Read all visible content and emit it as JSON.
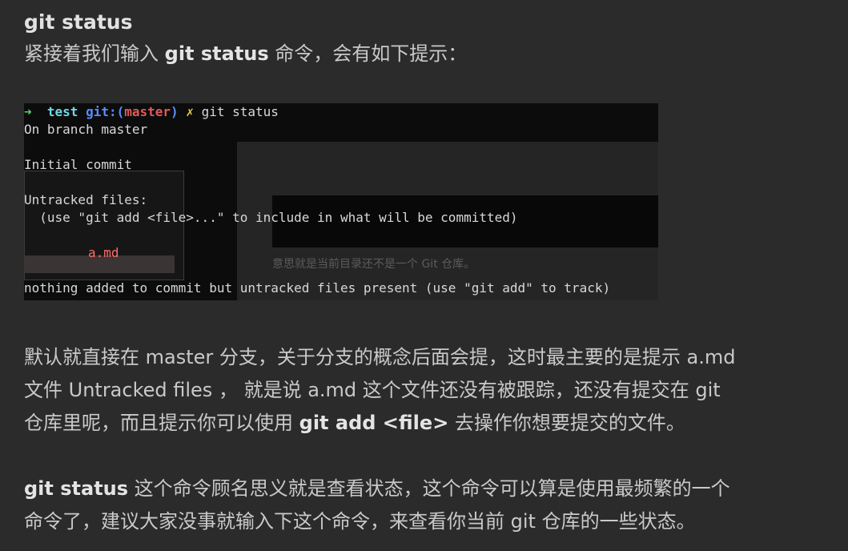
{
  "heading": "git status",
  "intro": {
    "pre": "紧接着我们输入 ",
    "cmd": "git status",
    "post": " 命令，会有如下提示："
  },
  "terminal": {
    "prompt_arrow": "➜",
    "prompt_dir": "test",
    "prompt_git": "git:(",
    "prompt_branch": "master",
    "prompt_close": ")",
    "prompt_x": "✗",
    "prompt_cmd": "git status",
    "lines": [
      "On branch master",
      "Initial commit",
      "Untracked files:",
      "  (use \"git add <file>...\" to include in what will be committed)",
      "a.md",
      "nothing added to commit but untracked files present (use \"git add\" to track)"
    ],
    "ghost_note": "意思就是当前目录还不是一个 Git 仓库。"
  },
  "para1": {
    "line1": "默认就直接在 master 分支，关于分支的概念后面会提，这时最主要的是提示 a.md",
    "line2": "文件 Untracked files ， 就是说 a.md 这个文件还没有被跟踪，还没有提交在 git",
    "line3_pre": "仓库里呢，而且提示你可以使用 ",
    "line3_cmd": "git add <file>",
    "line3_post": " 去操作你想要提交的文件。"
  },
  "para2": {
    "cmd": "git status",
    "line1_post": " 这个命令顾名思义就是查看状态，这个命令可以算是使用最频繁的一个",
    "line2": "命令了，建议大家没事就输入下这个命令，来查看你当前 git 仓库的一些状态。"
  }
}
